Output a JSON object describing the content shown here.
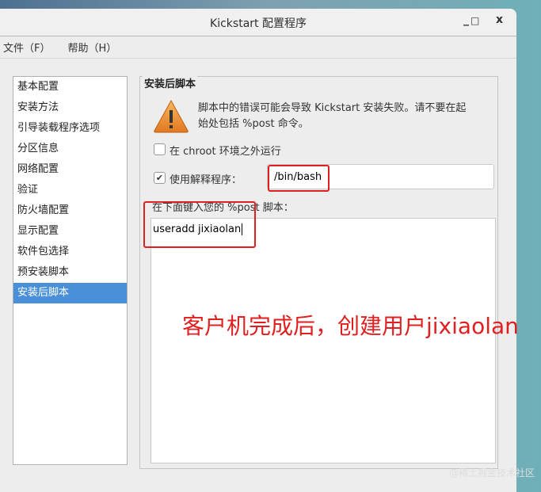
{
  "window": {
    "title": "Kickstart 配置程序",
    "minimize": "_",
    "maximize": "□",
    "close": "x"
  },
  "menu": [
    "文件（F）",
    "帮助（H）"
  ],
  "sidebar": {
    "items": [
      "基本配置",
      "安装方法",
      "引导装载程序选项",
      "分区信息",
      "网络配置",
      "验证",
      "防火墙配置",
      "显示配置",
      "软件包选择",
      "预安装脚本",
      "安装后脚本"
    ],
    "selected": 10
  },
  "panel": {
    "title": "安装后脚本",
    "warning": "脚本中的错误可能会导致 Kickstart 安装失败。请不要在起始处包括 %post 命令。",
    "chroot_label": "在 chroot 环境之外运行",
    "chroot_checked": false,
    "interp_label": "使用解释程序：",
    "interp_checked": true,
    "interp_value": "/bin/bash",
    "script_label": "在下面键入您的 %post 脚本：",
    "script_value": "useradd jixiaolan"
  },
  "annotation": "客户机完成后，创建用户jixiaolan",
  "watermark": "@稀土掘金技术社区"
}
